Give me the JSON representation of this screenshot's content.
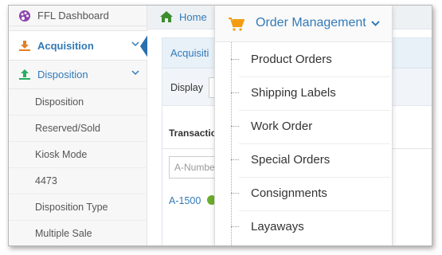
{
  "sidebar": {
    "dashboard_label": "FFL Dashboard",
    "acquisition_label": "Acquisition",
    "disposition_label": "Disposition",
    "items": [
      {
        "label": "Disposition"
      },
      {
        "label": "Reserved/Sold"
      },
      {
        "label": "Kiosk Mode"
      },
      {
        "label": "4473"
      },
      {
        "label": "Disposition Type"
      },
      {
        "label": "Multiple Sale"
      }
    ]
  },
  "topbar": {
    "home_label": "Home"
  },
  "panel": {
    "title": "Acquisiti",
    "display_label": "Display",
    "transaction_label": "Transactio",
    "a_number_placeholder": "A-Numbe",
    "row_link": "A-1500"
  },
  "menu": {
    "title": "Order Management",
    "items": [
      {
        "label": "Product Orders"
      },
      {
        "label": "Shipping Labels"
      },
      {
        "label": "Work Order"
      },
      {
        "label": "Special Orders"
      },
      {
        "label": "Consignments"
      },
      {
        "label": "Layaways"
      }
    ]
  },
  "colors": {
    "link_blue": "#337ab7",
    "cart_orange": "#f39c12",
    "home_green": "#3c8d2f",
    "status_green": "#6aad2a"
  },
  "icons": {
    "dashboard": "palette-icon",
    "acquisition": "download-icon",
    "disposition": "upload-icon",
    "home": "home-icon",
    "menu": "shopping-cart-icon"
  }
}
